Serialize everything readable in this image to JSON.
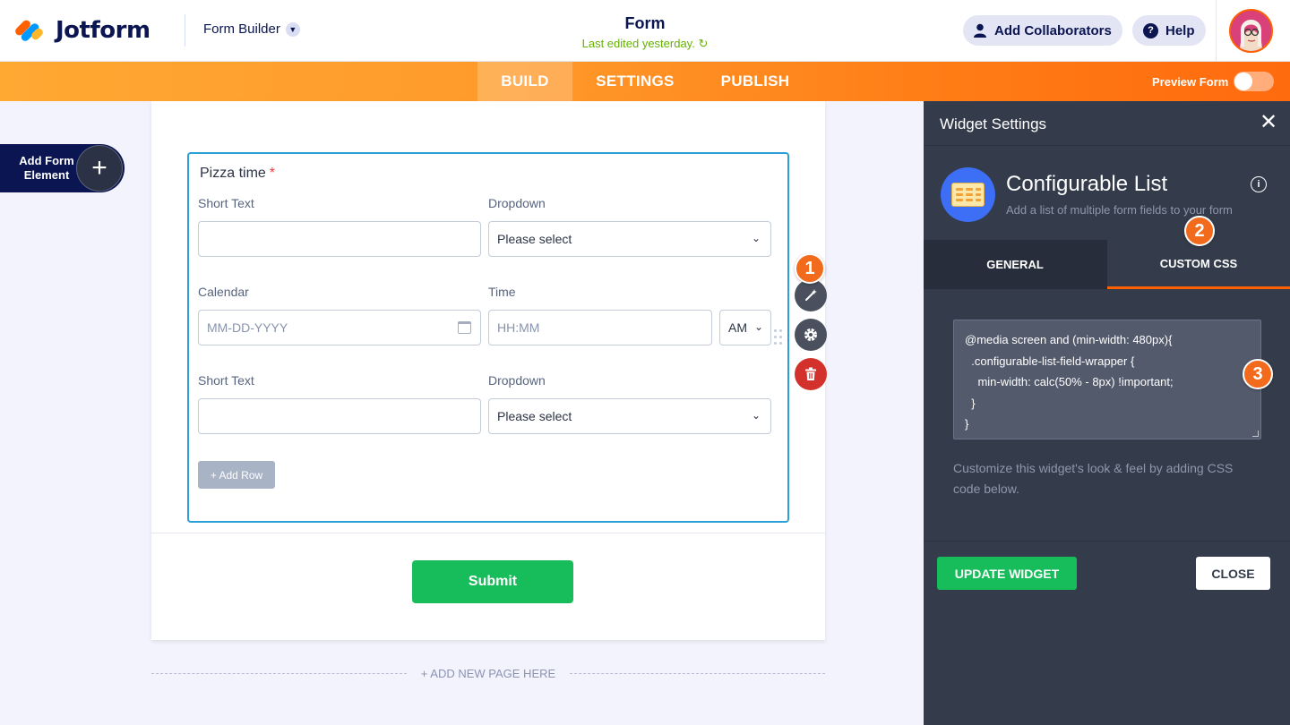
{
  "header": {
    "brand": "Jotform",
    "builder_switch": "Form Builder",
    "form_title": "Form",
    "last_edited": "Last edited yesterday.",
    "add_collaborators": "Add Collaborators",
    "help": "Help"
  },
  "nav": {
    "tabs": [
      {
        "label": "BUILD",
        "active": true
      },
      {
        "label": "SETTINGS",
        "active": false
      },
      {
        "label": "PUBLISH",
        "active": false
      }
    ],
    "preview_label": "Preview Form",
    "preview_on": false
  },
  "left": {
    "add_element_label": "Add Form Element"
  },
  "form": {
    "widget_title": "Pizza time",
    "required_mark": "*",
    "rows": [
      {
        "left_label": "Short Text",
        "left_value": "",
        "right_label": "Dropdown",
        "right_value": "Please select"
      },
      {
        "left_label": "Calendar",
        "left_placeholder": "MM-DD-YYYY",
        "right_label": "Time",
        "right_placeholder": "HH:MM",
        "ampm": "AM"
      },
      {
        "left_label": "Short Text",
        "left_value": "",
        "right_label": "Dropdown",
        "right_value": "Please select"
      }
    ],
    "add_row": "+ Add Row",
    "submit": "Submit",
    "add_new_page": "+ ADD NEW PAGE HERE"
  },
  "badges": [
    "1",
    "2",
    "3"
  ],
  "panel": {
    "title": "Widget Settings",
    "widget_name": "Configurable List",
    "widget_desc": "Add a list of multiple form fields to your form",
    "tabs": [
      {
        "label": "GENERAL",
        "active": false
      },
      {
        "label": "CUSTOM CSS",
        "active": true
      }
    ],
    "css_code": "@media screen and (min-width: 480px){\n  .configurable-list-field-wrapper {\n    min-width: calc(50% - 8px) !important;\n  }\n}",
    "css_hint": "Customize this widget's look & feel by adding CSS code below.",
    "update_button": "UPDATE WIDGET",
    "close_button": "CLOSE"
  },
  "colors": {
    "brand_orange": "#ff6100",
    "brand_navy": "#0a1551",
    "success_green": "#18bd5b",
    "panel_bg": "#343c4c",
    "danger_red": "#d2312c"
  }
}
